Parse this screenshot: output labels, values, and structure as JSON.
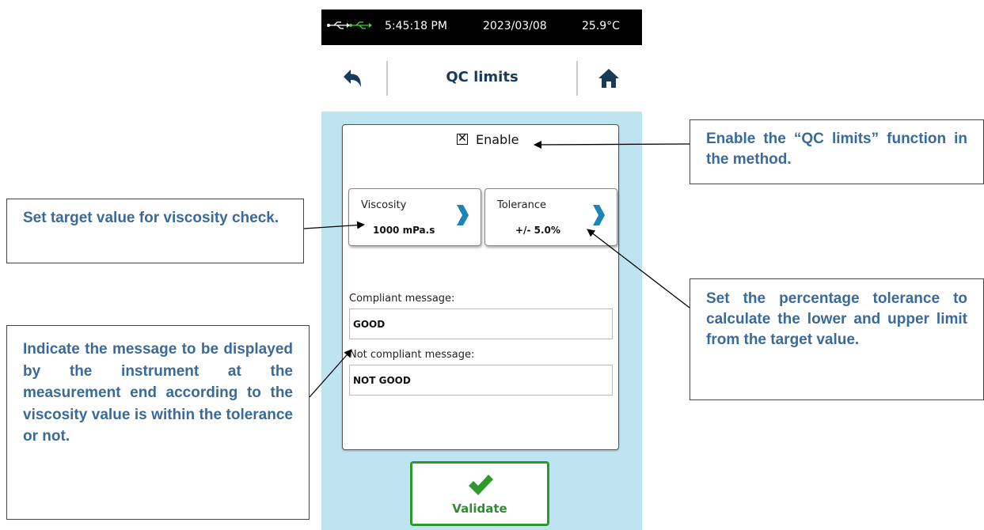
{
  "status_bar": {
    "usb_icon": "usb-connected-icon",
    "time": "5:45:18 PM",
    "date": "2023/03/08",
    "temperature": "25.9°C"
  },
  "header": {
    "title": "QC limits",
    "back_icon": "back-arrow-icon",
    "home_icon": "home-icon"
  },
  "form": {
    "enable": {
      "label": "Enable",
      "checked": true
    },
    "viscosity": {
      "label": "Viscosity",
      "value": "1000 mPa.s"
    },
    "tolerance": {
      "label": "Tolerance",
      "value": "+/- 5.0%"
    },
    "compliant_message": {
      "label": "Compliant message:",
      "value": "GOOD"
    },
    "not_compliant_message": {
      "label": "Not compliant message:",
      "value": "NOT GOOD"
    },
    "validate_label": "Validate"
  },
  "callouts": {
    "enable": "Enable the “QC limits” function in the method.",
    "viscosity": "Set target value for viscosity check.",
    "tolerance": "Set the percentage tolerance to calculate the lower and upper limit from the target value.",
    "messages": "Indicate the message to be displayed by the instrument at the measurement end according to the viscosity value is within the tolerance or not."
  },
  "colors": {
    "panel_bg": "#bfe4f1",
    "accent_blue": "#1a86b8",
    "validate_green": "#2e9a2e",
    "callout_text": "#3a6a9a",
    "header_title": "#1a3a5a"
  }
}
